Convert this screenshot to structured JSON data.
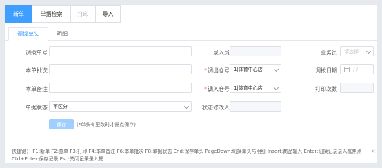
{
  "toolbar": {
    "new_label": "新单",
    "search_label": "单据检索",
    "print_label": "打印",
    "import_label": "导入"
  },
  "tabs": [
    {
      "label": "调拨单头"
    },
    {
      "label": "明细"
    }
  ],
  "form": {
    "bill_no_label": "调拨单号",
    "recorder_label": "录入员",
    "salesman_label": "业务员",
    "salesman_placeholder": "请选择",
    "batch_label": "本单批次",
    "out_wh_label": "调出仓号",
    "out_wh_value": "1|体育中心店",
    "date_label": "调拨日期",
    "date_placeholder": "/ /",
    "remark_label": "本单备注",
    "in_wh_label": "调入仓号",
    "in_wh_value": "1|体育中心店",
    "print_count_label": "打印次数",
    "status_label": "单据状态",
    "status_value": "不区分",
    "status_modifier_label": "状态修改人"
  },
  "save": {
    "label": "保存",
    "hint": "(*单头有更改时才需点保存)"
  },
  "shortcuts": {
    "text": "快捷键：  F1:新单 F2:查单 F3:打印 F4:本单备注 F6:本单批次 F8:单据状态 End:保存单头 PageDown:切换单头与明细 Insert:商品输入 Enter:切换记录录入框焦点 Ctrl+Enter:保存记录 Esc:关闭记录录入框",
    "close": "×"
  }
}
